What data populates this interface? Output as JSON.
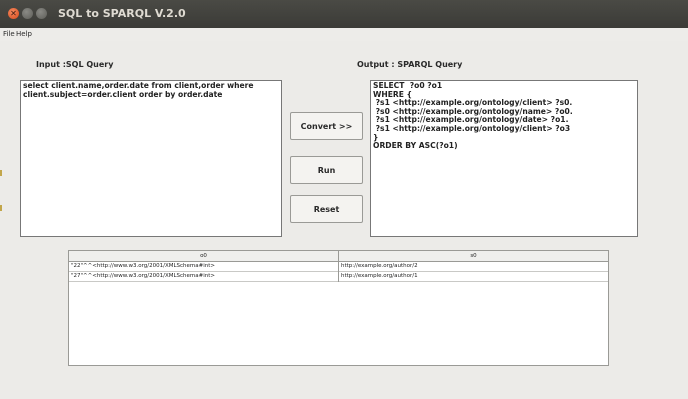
{
  "window": {
    "title": "SQL to SPARQL V.2.0"
  },
  "menu": {
    "items": [
      "File",
      "Help"
    ]
  },
  "input": {
    "label": "Input :SQL Query",
    "value": "select client.name,order.date from client,order where client.subject=order.client order by order.date"
  },
  "output": {
    "label": "Output  : SPARQL Query",
    "value": "SELECT  ?o0 ?o1\nWHERE {\n ?s1 <http://example.org/ontology/client> ?s0.\n ?s0 <http://example.org/ontology/name> ?o0.\n ?s1 <http://example.org/ontology/date> ?o1.\n ?s1 <http://example.org/ontology/client> ?o3\n}\nORDER BY ASC(?o1)"
  },
  "buttons": {
    "convert": "Convert >>",
    "run": "Run",
    "reset": "Reset"
  },
  "results": {
    "columns": [
      "o0",
      "s0"
    ],
    "rows": [
      [
        "\"22\"^^<http://www.w3.org/2001/XMLSchema#int>",
        "http://example.org/author/2"
      ],
      [
        "\"27\"^^<http://www.w3.org/2001/XMLSchema#int>",
        "http://example.org/author/1"
      ]
    ]
  }
}
